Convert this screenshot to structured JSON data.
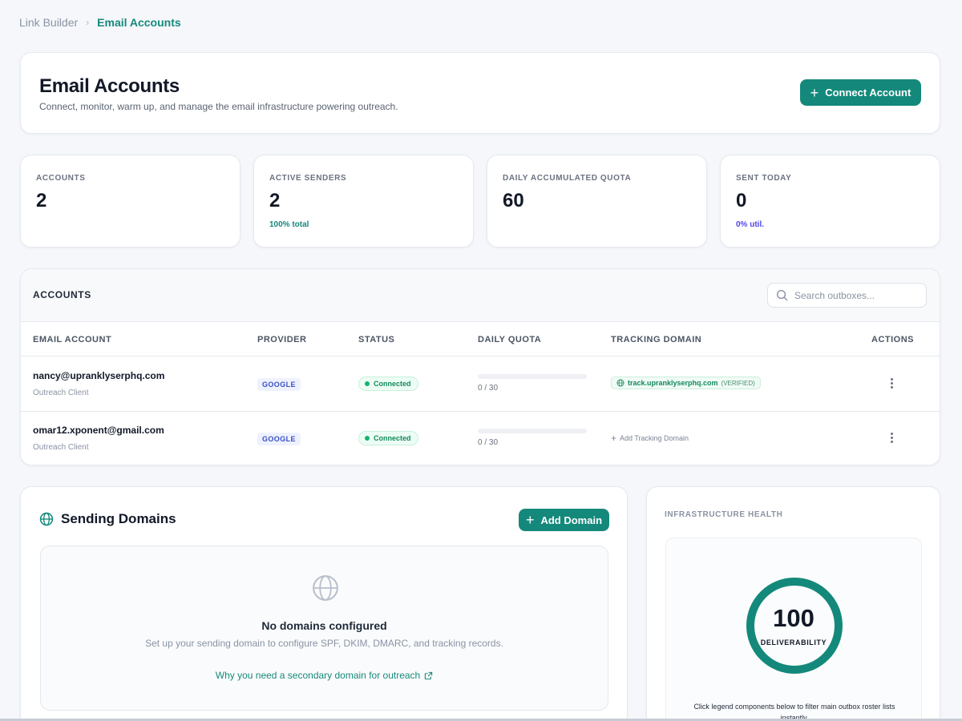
{
  "breadcrumb": {
    "parent": "Link Builder",
    "separator": "›",
    "current": "Email Accounts"
  },
  "header": {
    "title": "Email Accounts",
    "subtitle": "Connect, monitor, warm up, and manage the email infrastructure powering outreach.",
    "connect_button": "Connect Account"
  },
  "stats": [
    {
      "label": "ACCOUNTS",
      "value": "2",
      "note": ""
    },
    {
      "label": "ACTIVE SENDERS",
      "value": "2",
      "note": "100% total",
      "note_color": "#14897b"
    },
    {
      "label": "DAILY ACCUMULATED QUOTA",
      "value": "60",
      "note": ""
    },
    {
      "label": "SENT TODAY",
      "value": "0",
      "note": "0% util.",
      "note_color": "#4f46e5"
    }
  ],
  "accounts": {
    "title": "ACCOUNTS",
    "search_placeholder": "Search outboxes...",
    "columns": [
      "EMAIL ACCOUNT",
      "PROVIDER",
      "STATUS",
      "DAILY QUOTA",
      "TRACKING DOMAIN",
      "ACTIONS"
    ],
    "rows": [
      {
        "email": "nancy@upranklyserphq.com",
        "client": "Outreach Client",
        "provider": "GOOGLE",
        "status": "Connected",
        "quota": "0 / 30",
        "quota_fraction": 0,
        "tracking_domain": "track.upranklyserphq.com",
        "tracking_state": "(VERIFIED)"
      },
      {
        "email": "omar12.xponent@gmail.com",
        "client": "Outreach Client",
        "provider": "GOOGLE",
        "status": "Connected",
        "quota": "0 / 30",
        "quota_fraction": 0,
        "add_tracking": "Add Tracking Domain"
      }
    ]
  },
  "domains": {
    "title": "Sending Domains",
    "add_button": "Add Domain",
    "empty_title": "No domains configured",
    "empty_description": "Set up your sending domain to configure SPF, DKIM, DMARC, and tracking records.",
    "help_link": "Why you need a secondary domain for outreach"
  },
  "health": {
    "title": "INFRASTRUCTURE HEALTH",
    "score": "100",
    "score_label": "DELIVERABILITY",
    "score_fraction": 1.0,
    "hint": "Click legend components below to filter main outbox roster lists instantly."
  },
  "colors": {
    "accent": "#14897b",
    "connected": "#138a5b",
    "provider": "#3b4fc4",
    "util": "#4f46e5"
  },
  "icons": {
    "breadcrumb_separator": "chevron-right-icon",
    "connect": "plus-icon",
    "search": "search-icon",
    "status": "dot-icon",
    "tracking": "globe-icon",
    "actions": "kebab-menu-icon",
    "domains": "globe-icon",
    "external_link": "external-link-icon"
  }
}
